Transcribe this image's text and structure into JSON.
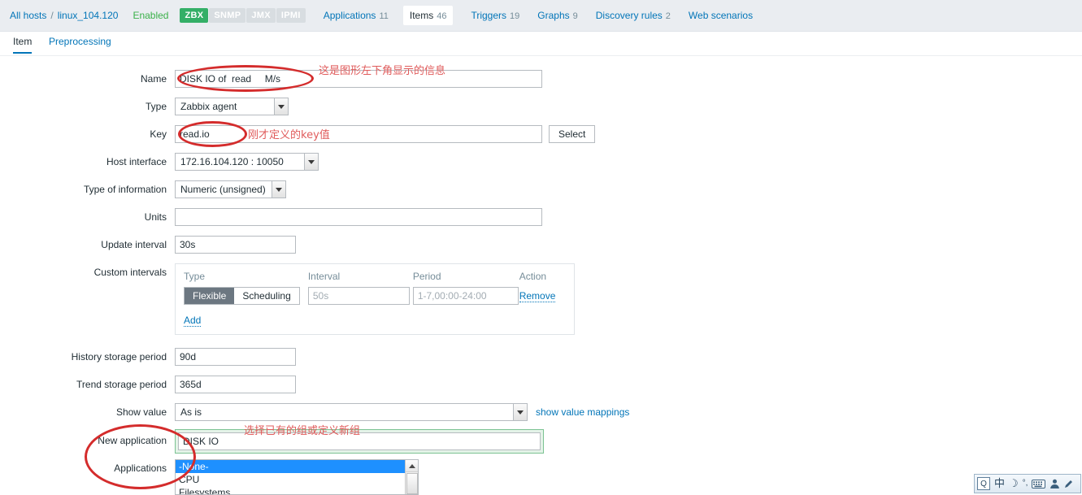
{
  "header": {
    "all_hosts": "All hosts",
    "separator": "/",
    "host": "linux_104.120",
    "status": "Enabled",
    "protocols": [
      {
        "label": "ZBX",
        "active": true
      },
      {
        "label": "SNMP",
        "active": false
      },
      {
        "label": "JMX",
        "active": false
      },
      {
        "label": "IPMI",
        "active": false
      }
    ],
    "nav": [
      {
        "label": "Applications",
        "count": "11",
        "selected": false
      },
      {
        "label": "Items",
        "count": "46",
        "selected": true
      },
      {
        "label": "Triggers",
        "count": "19",
        "selected": false
      },
      {
        "label": "Graphs",
        "count": "9",
        "selected": false
      },
      {
        "label": "Discovery rules",
        "count": "2",
        "selected": false
      },
      {
        "label": "Web scenarios",
        "count": "",
        "selected": false
      }
    ]
  },
  "tabs": {
    "item": "Item",
    "preprocessing": "Preprocessing"
  },
  "form": {
    "name_label": "Name",
    "name_value": "DISK IO of  read     M/s",
    "type_label": "Type",
    "type_value": "Zabbix agent",
    "key_label": "Key",
    "key_value": "read.io",
    "select_button": "Select",
    "host_interface_label": "Host interface",
    "host_interface_value": "172.16.104.120 : 10050",
    "type_of_information_label": "Type of information",
    "type_of_information_value": "Numeric (unsigned)",
    "units_label": "Units",
    "units_value": "",
    "update_interval_label": "Update interval",
    "update_interval_value": "30s",
    "custom_intervals_label": "Custom intervals",
    "custom_intervals": {
      "col_type": "Type",
      "col_interval": "Interval",
      "col_period": "Period",
      "col_action": "Action",
      "seg_flexible": "Flexible",
      "seg_scheduling": "Scheduling",
      "selected_seg": "Flexible",
      "interval_placeholder": "50s",
      "interval_value": "",
      "period_placeholder": "1-7,00:00-24:00",
      "period_value": "",
      "remove_label": "Remove",
      "add_label": "Add"
    },
    "history_label": "History storage period",
    "history_value": "90d",
    "trend_label": "Trend storage period",
    "trend_value": "365d",
    "show_value_label": "Show value",
    "show_value_value": "As is",
    "show_value_mappings_link": "show value mappings",
    "new_application_label": "New application",
    "new_application_value": "DISK IO",
    "applications_label": "Applications",
    "applications_options": [
      "-None-",
      "CPU",
      "Filesystems"
    ],
    "applications_selected": "-None-"
  },
  "annotations": {
    "name_note": "这是图形左下角显示的信息",
    "key_note": "刚才定义的key值",
    "application_note": "选择已有的组或定义新组"
  },
  "ime": {
    "logo": "Q",
    "lang": "中",
    "moon": "☽",
    "punct": "°,",
    "keyboard": "keyboard-icon",
    "toolbox": "toolbox-icon"
  },
  "colors": {
    "accent": "#0275b8",
    "green": "#34af67",
    "annotation_red": "#d42c2c",
    "highlight_green": "#7cc393",
    "select_blue": "#1e90ff"
  }
}
